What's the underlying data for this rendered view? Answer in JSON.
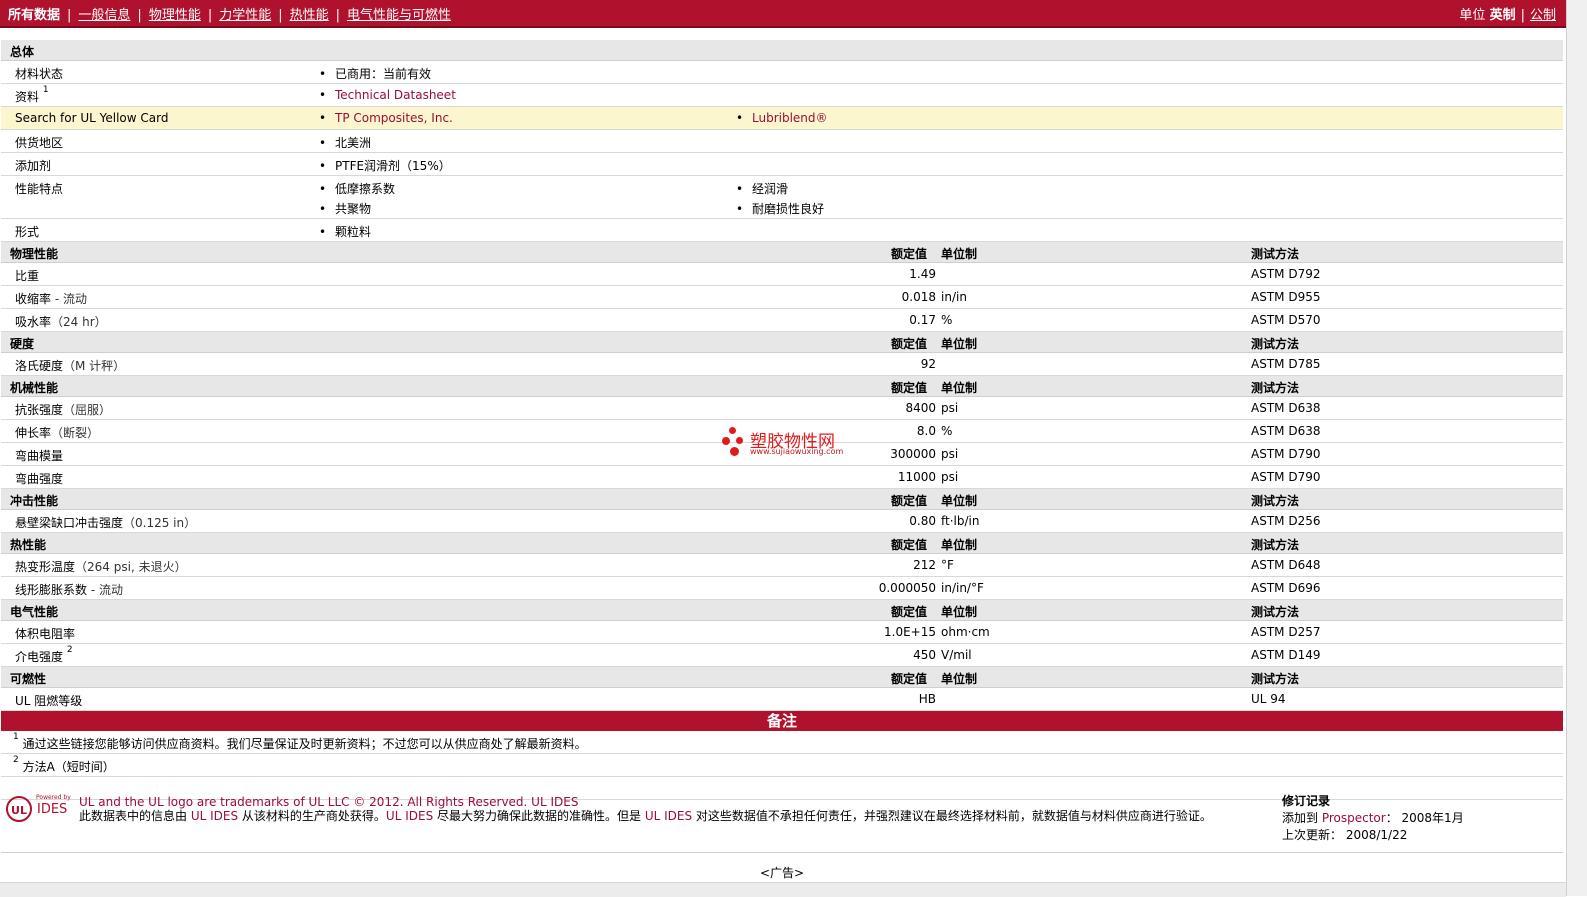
{
  "nav": {
    "tabs": [
      "所有数据",
      "一般信息",
      "物理性能",
      "力学性能",
      "热性能",
      "电气性能与可燃性"
    ],
    "units_label": "单位",
    "units_current": "英制",
    "units_other": "公制"
  },
  "general": {
    "title": "总体",
    "rows": [
      {
        "label": "材料状态",
        "values": [
          "已商用：当前有效"
        ]
      },
      {
        "label": "资料",
        "sup": "1",
        "values": [
          "Technical Datasheet"
        ]
      },
      {
        "label": "Search for UL Yellow Card",
        "values": [
          "TP Composites, Inc.",
          "Lubriblend®"
        ]
      },
      {
        "label": "供货地区",
        "values": [
          "北美洲"
        ]
      },
      {
        "label": "添加剂",
        "values": [
          "PTFE润滑剂（15%）"
        ]
      },
      {
        "label": "性能特点",
        "values": [
          "低摩擦系数",
          "经润滑",
          "共聚物",
          "耐磨损性良好"
        ]
      },
      {
        "label": "形式",
        "values": [
          "颗粒料"
        ]
      }
    ]
  },
  "col_headers": {
    "value": "额定值",
    "unit": "单位制",
    "test": "测试方法"
  },
  "sections": [
    {
      "title": "物理性能",
      "rows": [
        {
          "label": "比重",
          "qual": "",
          "value": "1.49",
          "unit": "",
          "test": "ASTM D792"
        },
        {
          "label": "收缩率",
          "qual": " - 流动",
          "value": "0.018",
          "unit": "in/in",
          "test": "ASTM D955"
        },
        {
          "label": "吸水率",
          "qual": "（24 hr）",
          "value": "0.17",
          "unit": "%",
          "test": "ASTM D570"
        }
      ]
    },
    {
      "title": "硬度",
      "rows": [
        {
          "label": "洛氏硬度",
          "qual": "（M 计秤）",
          "value": "92",
          "unit": "",
          "test": "ASTM D785"
        }
      ]
    },
    {
      "title": "机械性能",
      "rows": [
        {
          "label": "抗张强度",
          "qual": "（屈服）",
          "value": "8400",
          "unit": "psi",
          "test": "ASTM D638"
        },
        {
          "label": "伸长率",
          "qual": "（断裂）",
          "value": "8.0",
          "unit": "%",
          "test": "ASTM D638"
        },
        {
          "label": "弯曲模量",
          "qual": "",
          "value": "300000",
          "unit": "psi",
          "test": "ASTM D790"
        },
        {
          "label": "弯曲强度",
          "qual": "",
          "value": "11000",
          "unit": "psi",
          "test": "ASTM D790"
        }
      ]
    },
    {
      "title": "冲击性能",
      "rows": [
        {
          "label": "悬壁梁缺口冲击强度",
          "qual": "（0.125 in）",
          "value": "0.80",
          "unit": "ft·lb/in",
          "test": "ASTM D256"
        }
      ]
    },
    {
      "title": "热性能",
      "rows": [
        {
          "label": "热变形温度",
          "qual": "（264 psi, 未退火）",
          "value": "212",
          "unit": "°F",
          "test": "ASTM D648"
        },
        {
          "label": "线形膨胀系数",
          "qual": " - 流动",
          "value": "0.000050",
          "unit": "in/in/°F",
          "test": "ASTM D696"
        }
      ]
    },
    {
      "title": "电气性能",
      "rows": [
        {
          "label": "体积电阻率",
          "qual": "",
          "value": "1.0E+15",
          "unit": "ohm·cm",
          "test": "ASTM D257"
        },
        {
          "label": "介电强度",
          "sup": "2",
          "qual": "",
          "value": "450",
          "unit": "V/mil",
          "test": "ASTM D149"
        }
      ]
    },
    {
      "title": "可燃性",
      "rows": [
        {
          "label": "UL 阻燃等级",
          "qual": "",
          "value": "HB",
          "unit": "",
          "test": "UL 94"
        }
      ]
    }
  ],
  "notes": {
    "title": "备注",
    "items": [
      {
        "num": "1",
        "text": "通过这些链接您能够访问供应商资料。我们尽量保证及时更新资料；不过您可以从供应商处了解最新资料。"
      },
      {
        "num": "2",
        "text": "方法A（短时间）"
      }
    ]
  },
  "footer": {
    "logo_text": "UL",
    "logo_powered": "Powered by",
    "logo_ides": "IDES",
    "line1": "UL and the UL logo are trademarks of UL LLC © 2012. All Rights Reserved. UL IDES",
    "line2_a": "此数据表中的信息由 ",
    "line2_link1": "UL IDES",
    "line2_b": " 从该材料的生产商处获得。",
    "line2_link2": "UL IDES",
    "line2_c": " 尽最大努力确保此数据的准确性。但是 ",
    "line2_link3": "UL IDES",
    "line2_d": " 对这些数据值不承担任何责任，并强烈建议在最终选择材料前，就数据值与材料供应商进行验证。",
    "rev_title": "修订记录",
    "rev_added_label": "添加到 ",
    "rev_added_link": "Prospector",
    "rev_added_value": "：   2008年1月",
    "rev_updated_label": "上次更新：",
    "rev_updated_value": "   2008/1/22",
    "ad": "<广告>"
  },
  "watermark": {
    "text": "塑胶物性网",
    "url": "www.sujiaowuxing.com"
  },
  "colors": {
    "brand_red": "#b0112c",
    "link": "#9b0c3a",
    "highlight": "#fcf6cf",
    "section_bg": "#e7e7e7"
  }
}
